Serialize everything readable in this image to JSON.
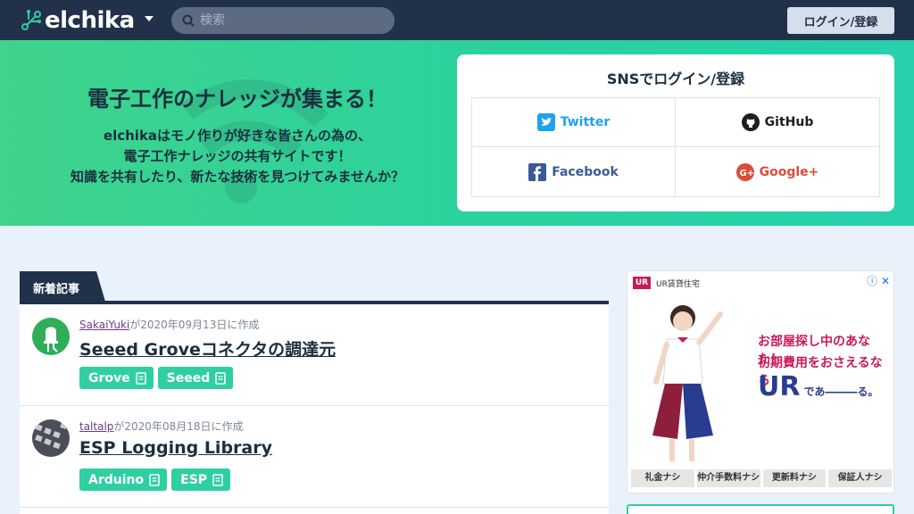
{
  "header": {
    "logo_text": "elchika",
    "search_placeholder": "検索",
    "login_label": "ログイン/登録"
  },
  "hero": {
    "title": "電子工作のナレッジが集まる！",
    "lines": [
      "elchikaはモノ作りが好きな皆さんの為の、",
      "電子工作ナレッジの共有サイトです！",
      "知識を共有したり、新たな技術を見つけてみませんか？"
    ]
  },
  "sns": {
    "title": "SNSでログイン/登録",
    "buttons": [
      {
        "label": "Twitter",
        "icon": "twitter-icon",
        "color": "#1da1f2"
      },
      {
        "label": "GitHub",
        "icon": "github-icon",
        "color": "#1b1f23"
      },
      {
        "label": "Facebook",
        "icon": "facebook-icon",
        "color": "#3b5998"
      },
      {
        "label": "Google+",
        "icon": "google-plus-icon",
        "color": "#dd4b39"
      }
    ]
  },
  "articles": {
    "tab_label": "新着記事",
    "items": [
      {
        "author": "SakaiYuki",
        "meta_suffix": "が2020年09月13日に作成",
        "title": "Seeed Groveコネクタの調達元",
        "tags": [
          "Grove",
          "Seeed"
        ]
      },
      {
        "author": "taltalp",
        "meta_suffix": "が2020年08月18日に作成",
        "title": "ESP Logging Library",
        "tags": [
          "Arduino",
          "ESP"
        ]
      }
    ]
  },
  "ad": {
    "brand": "UR賃貸住宅",
    "logo": "UR",
    "copy1": "お部屋探し中のあなた！",
    "copy2": "初期費用をおさえるなら",
    "ur_big": "UR",
    "ur_small": "であ―――る。",
    "chips": [
      "礼金ナシ",
      "仲介手数料ナシ",
      "更新料ナシ",
      "保証人ナシ"
    ]
  },
  "colors": {
    "nav": "#22314a",
    "accent": "#2fcfa3",
    "hero_start": "#3fd38c",
    "hero_end": "#28d0ae"
  }
}
